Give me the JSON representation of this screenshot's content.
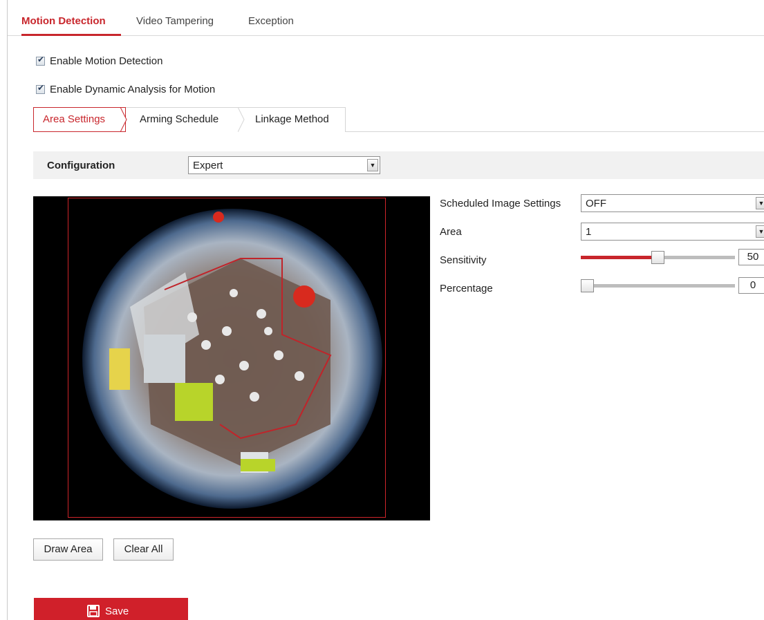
{
  "tabs": [
    "Motion Detection",
    "Video Tampering",
    "Exception"
  ],
  "enable_motion": {
    "label": "Enable Motion Detection",
    "checked": true
  },
  "enable_dynamic": {
    "label": "Enable Dynamic Analysis for Motion",
    "checked": true
  },
  "subtabs": [
    "Area Settings",
    "Arming Schedule",
    "Linkage Method"
  ],
  "configuration": {
    "label": "Configuration",
    "value": "Expert"
  },
  "settings": {
    "scheduled": {
      "label": "Scheduled Image Settings",
      "value": "OFF"
    },
    "area": {
      "label": "Area",
      "value": "1"
    },
    "sensitivity": {
      "label": "Sensitivity",
      "value": "50"
    },
    "percentage": {
      "label": "Percentage",
      "value": "0"
    }
  },
  "buttons": {
    "draw_area": "Draw Area",
    "clear_all": "Clear All",
    "save": "Save"
  },
  "colors": {
    "accent": "#c8262c",
    "save_bg": "#d0202a"
  },
  "icons": {
    "checkbox": "check-icon",
    "dropdown": "chevron-down-icon",
    "save": "floppy-disk-icon"
  }
}
